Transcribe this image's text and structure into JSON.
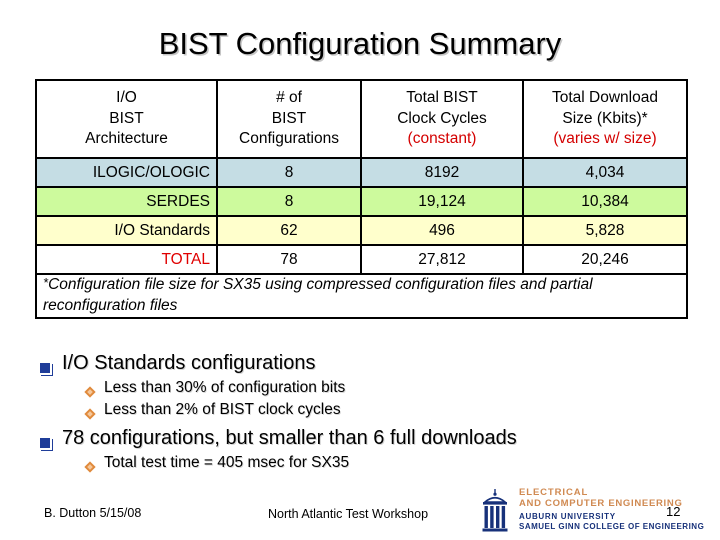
{
  "slide": {
    "title": "BIST Configuration Summary",
    "page_number": "12"
  },
  "table": {
    "headers": [
      {
        "line1": "I/O",
        "line2": "BIST",
        "line3": "Architecture",
        "line3_red": ""
      },
      {
        "line1": "# of",
        "line2": "BIST",
        "line3": "Configurations",
        "line3_red": ""
      },
      {
        "line1": "Total BIST",
        "line2": "Clock Cycles",
        "line3": "",
        "line3_red": "(constant)"
      },
      {
        "line1": "Total Download",
        "line2": "Size (Kbits)*",
        "line3": "",
        "line3_red": "(varies w/ size)"
      }
    ],
    "rows": [
      {
        "label": "ILOGIC/OLOGIC",
        "configs": "8",
        "clock_cycles": "8192",
        "download_size": "4,034",
        "color": "#c5dde4"
      },
      {
        "label": "SERDES",
        "configs": "8",
        "clock_cycles": "19,124",
        "download_size": "10,384",
        "color": "#cdfa9d"
      },
      {
        "label": "I/O Standards",
        "configs": "62",
        "clock_cycles": "496",
        "download_size": "5,828",
        "color": "#ffffcc"
      },
      {
        "label": "TOTAL",
        "configs": "78",
        "clock_cycles": "27,812",
        "download_size": "20,246",
        "color": "#ffffff"
      }
    ],
    "footnote_marker": "*",
    "footnote": "Configuration file size for SX35 using compressed configuration files and partial reconfiguration files"
  },
  "bullets": [
    {
      "text": "I/O Standards configurations",
      "sub": [
        "Less than 30% of configuration bits",
        "Less than 2% of BIST clock cycles"
      ]
    },
    {
      "text": "78 configurations, but smaller than 6 full downloads",
      "sub": [
        "Total test time = 405 msec for SX35"
      ]
    }
  ],
  "footer": {
    "author": "B. Dutton 5/15/08",
    "venue": "North Atlantic Test Workshop"
  },
  "logo": {
    "line1": "ELECTRICAL",
    "line2": "AND COMPUTER ENGINEERING",
    "line3": "AUBURN UNIVERSITY",
    "line4": "SAMUEL GINN COLLEGE OF ENGINEERING",
    "accent_color": "#d08a52",
    "navy_color": "#17317a"
  },
  "colors": {
    "header_text": "#1111bb",
    "header_red": "#d40000",
    "total_red": "#e00000",
    "bullet_square": "#1f3d99",
    "bullet_diamond": "#e08a3c"
  }
}
